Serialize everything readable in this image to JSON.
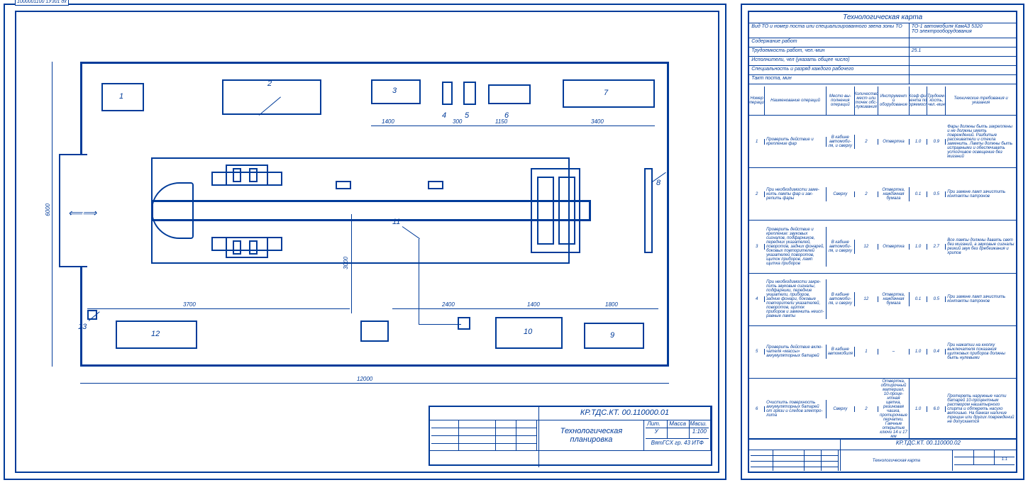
{
  "top_code": "1000001100 1У301 дх",
  "plan": {
    "labels": {
      "b1": "1",
      "b2": "2",
      "b3": "3",
      "b4": "4",
      "b5": "5",
      "b6": "6",
      "b7": "7",
      "b8": "8",
      "b9": "9",
      "b10": "10",
      "b11": "11",
      "b12": "12",
      "b13": "13"
    },
    "dims": {
      "v_total": "6000",
      "v_mid": "3000",
      "h_3700": "3700",
      "h_1400": "1400",
      "h_300": "300",
      "h_1150": "1150",
      "h_3400": "3400",
      "h_2400": "2400",
      "h_1400b": "1400",
      "h_1800": "1800",
      "h_total": "12000"
    }
  },
  "titleblock_left": {
    "code": "КР.ТДС.КТ. 00.110000.01",
    "title": "Технологическая планировка",
    "lit": "У",
    "scale": "1:100",
    "org": "ВятГСХ гр. 43 ИТФ"
  },
  "card": {
    "title": "Технологическая карта",
    "row1_label": "Вид ТО и номер поста или специализированного звена зоны ТО",
    "row1_value": "ТО-1 автомобиля КамАЗ 5320\nТО электрооборудования",
    "row2_label": "Содержание работ",
    "row3_label": "Трудоемкость работ, чел.-мин",
    "row3_value": "25.1",
    "row4_label": "Исполнители, чел (указать общее число)",
    "row5_label": "Специальность и разряд каждого рабочего",
    "row6_label": "Такт поста, мин"
  },
  "op_headers": {
    "c1": "Номер операции",
    "c2": "Наименование операций",
    "c3": "Место вы­полнения операций",
    "c4": "Количество мест или точек обс­луживания",
    "c5": "Инструмент и оборудование",
    "c6": "Коэф фи­циента пов­торяемости",
    "c7": "Трудоем­кость, чел.-мин",
    "c8": "Технические требования и указания"
  },
  "ops": [
    {
      "n": "1",
      "name": "Проверить действие и крепление фар",
      "place": "В кабине автомоби­ля, и сверху",
      "qty": "2",
      "tool": "Отвертка",
      "k": "1.0",
      "t": "0.9",
      "req": "Фары должны быть зак­реплены и не должны иметь повреждений. Разбитые рассеиватели и стекла заменить. Лам­пы должны быть исправ­ными и обеспечивать устойчивое освещение без миганий"
    },
    {
      "n": "2",
      "name": "При необходимости заме­нить лампы фар и зак­репить фары",
      "place": "Сверху",
      "qty": "2",
      "tool": "Отвертка, наждачная бумага",
      "k": "0.1",
      "t": "0.5",
      "req": "При замене ламп зачис­тить контакты патро­нов"
    },
    {
      "n": "3",
      "name": "Проверить действие и креп­ление: звуковых сигналов, подфарников, передних ука­зателей, поворотов, зад­них фонарей, боковых пов­торителей указателей поворотов, щиток приборов, ламп щитка приборов",
      "place": "В кабине автомоби­ля, и сверху",
      "qty": "12",
      "tool": "Отвертка",
      "k": "1.0",
      "t": "2.7",
      "req": "Все лампы должны давать свет без миганий, а звуковые сигналы резкий звук без дре­безжания и хрипов"
    },
    {
      "n": "4",
      "name": "При необходимости закре­пить звуковые сигналы, подфарни­ки, передние указатели, приборов, задние фонари, боковые повторители ука­зателей, поворотов, щиток приборов и заменить неисп­равные лампы",
      "place": "В кабине автомоби­ля, и сверху",
      "qty": "12",
      "tool": "Отвертка, наждачная бумага",
      "k": "0.1",
      "t": "0.5",
      "req": "При замене ламп за­чистить контакты патронов"
    },
    {
      "n": "5",
      "name": "Проверить действие вклю­чателя «массы» аккумулятор­ных батарей",
      "place": "В кабине автомобиля",
      "qty": "1",
      "tool": "–",
      "k": "1.0",
      "t": "0.4",
      "req": "При нажатии на кноп­ку выключателя пока­зания щитковых при­боров должны быть нулевыми"
    },
    {
      "n": "6",
      "name": "Очистить поверхность аккумуляторных батарей от грязи и следов электро­лита",
      "place": "Сверху",
      "qty": "2",
      "tool": "Отвертка, об­тирочный ма­териал, 10-проце­нтная щетка, резиновая чаш­ка, протирочные перчатки. Гаеч­ные открытые ключи 14 и 17 мм",
      "k": "1.0",
      "t": "6.0",
      "req": "Протереть наружные части батарей 10-процентным раствором нашатырного спирта и обтереть насухо ветошью. На банках наличие трещин или других повреждений не допускается"
    }
  ],
  "titleblock_right": {
    "code": "КР.ТДС.КТ. 00.110000.02",
    "title": "Технологическая карта",
    "scale": "1:1"
  }
}
